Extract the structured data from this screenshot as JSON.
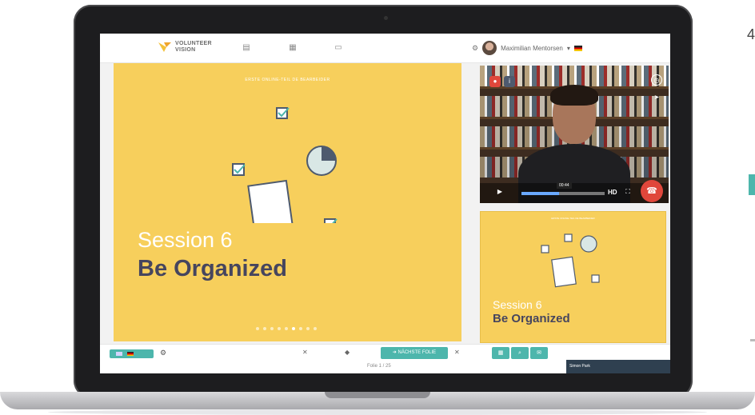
{
  "header": {
    "logo_text": "VOLUNTEER VISION",
    "user_name": "Maximilian Mentorsen"
  },
  "slide": {
    "header": "ERSTE ONLINE-TEIL DE BEARBEIDER",
    "session": "Session 6",
    "title": "Be Organized",
    "pager_dots": 9,
    "active_dot": 6
  },
  "video": {
    "time": "00:44",
    "quality": "HD",
    "progress": 0.45
  },
  "mini_slide": {
    "header": "ERSTE ONLINE-TEIL DE BEARBEIDER",
    "session": "Session 6",
    "title": "Be Organized"
  },
  "bottom": {
    "next_label": "NÄCHSTE FOLIE",
    "folie_text": "Folie 1 / 25",
    "name_tag": "Simon Park"
  },
  "colors": {
    "accent": "#4db6ac",
    "slide": "#f7cf5c",
    "title": "#46455e",
    "hangup": "#e0473b"
  },
  "icons": [
    "logo-mark",
    "notes-icon",
    "calendar-icon",
    "monitor-icon",
    "gear-icon",
    "flag-icon",
    "back-icon",
    "forward-icon",
    "close-icon",
    "mute-icon",
    "info-icon",
    "clock-icon",
    "send-icon",
    "play-icon",
    "fullscreen-icon",
    "hangup-icon",
    "settings-icon",
    "tool-grid-icon",
    "tool-search-icon",
    "tool-chat-icon"
  ]
}
